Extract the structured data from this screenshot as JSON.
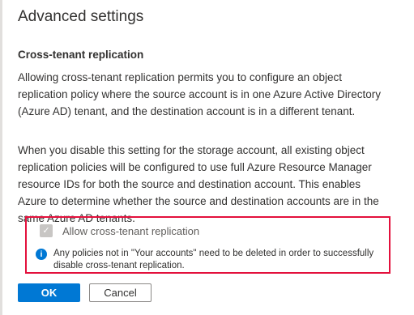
{
  "dialog": {
    "title": "Advanced settings"
  },
  "section": {
    "heading": "Cross-tenant replication",
    "paragraph1": "Allowing cross-tenant replication permits you to configure an object replication policy where the source account is in one Azure Active Directory (Azure AD) tenant, and the destination account is in a different tenant.",
    "paragraph2": "When you disable this setting for the storage account, all existing object replication policies will be configured to use full Azure Resource Manager resource IDs for both the source and destination account. This enables Azure to determine whether the source and destination accounts are in the same Azure AD tenants."
  },
  "setting": {
    "checkbox_label": "Allow cross-tenant replication",
    "checked": true,
    "disabled": true,
    "info_icon": "info-icon",
    "info_text": "Any policies not in \"Your accounts\" need to be deleted in order to successfully disable cross-tenant replication."
  },
  "buttons": {
    "ok_label": "OK",
    "cancel_label": "Cancel"
  },
  "colors": {
    "accent": "#0078d4",
    "highlight_border": "#e3103c",
    "disabled_check": "#c8c6c4"
  }
}
